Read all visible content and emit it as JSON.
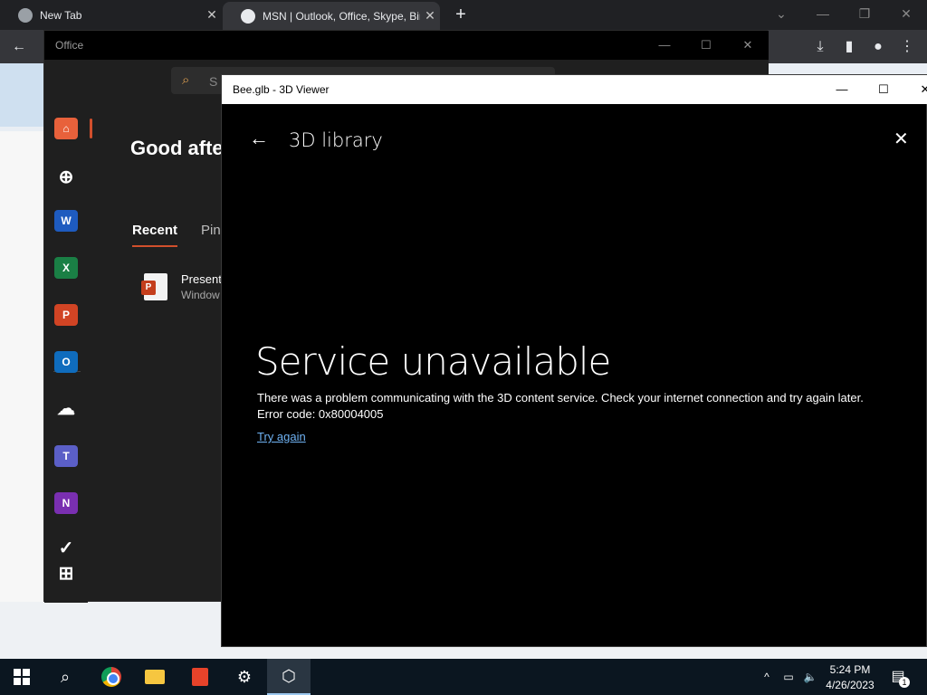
{
  "chrome": {
    "tabs": [
      {
        "title": "New Tab",
        "close": "✕"
      },
      {
        "title": "MSN | Outlook, Office, Skype, Bir",
        "close": "✕"
      }
    ],
    "new_tab": "+",
    "window_controls": {
      "dropdown": "⌄",
      "minimize": "—",
      "restore": "❐",
      "close": "✕"
    },
    "toolbar": {
      "back": "←",
      "download": "⤓",
      "sidebar": "▮",
      "profile": "●",
      "menu": "⋮"
    }
  },
  "office": {
    "title": "Office",
    "window_controls": {
      "minimize": "—",
      "maximize": "☐",
      "close": "✕"
    },
    "search_icon": "⌕",
    "search_text": "S",
    "greeting": "Good afte",
    "tabs": {
      "recent": "Recent",
      "pinned": "Pin"
    },
    "file": {
      "name": "Present",
      "location": "Window",
      "badge": "P"
    },
    "rail": [
      {
        "name": "home-icon",
        "glyph": "⌂",
        "color": "#e8613b"
      },
      {
        "name": "create-icon",
        "glyph": "⊕",
        "color": "transparent"
      },
      {
        "name": "word-icon",
        "glyph": "W",
        "color": "#1e5bbf"
      },
      {
        "name": "excel-icon",
        "glyph": "X",
        "color": "#1a7f45"
      },
      {
        "name": "powerpoint-icon",
        "glyph": "P",
        "color": "#d14424"
      },
      {
        "name": "outlook-icon",
        "glyph": "O",
        "color": "#0f6cbd"
      },
      {
        "name": "onedrive-icon",
        "glyph": "☁",
        "color": "transparent"
      },
      {
        "name": "teams-icon",
        "glyph": "T",
        "color": "#5b5fc7"
      },
      {
        "name": "onenote-icon",
        "glyph": "N",
        "color": "#7a2fb1"
      },
      {
        "name": "todo-icon",
        "glyph": "✓",
        "color": "transparent"
      },
      {
        "name": "apps-icon",
        "glyph": "⊞",
        "color": "transparent"
      }
    ]
  },
  "viewer": {
    "title": "Bee.glb - 3D Viewer",
    "window_controls": {
      "minimize": "—",
      "maximize": "☐",
      "close": "✕"
    },
    "back": "←",
    "heading": "3D library",
    "close": "✕",
    "error": {
      "title": "Service unavailable",
      "message": "There was a problem communicating with the 3D content service. Check your internet connection and try again later.",
      "code": "Error code: 0x80004005",
      "retry": "Try again"
    }
  },
  "taskbar": {
    "search_icon": "⌕",
    "settings_icon": "⚙",
    "viewer_icon": "⬡",
    "tray": {
      "chevron": "^",
      "network": "▭",
      "volume": "🔈"
    },
    "time": "5:24 PM",
    "date": "4/26/2023",
    "notification_count": "1",
    "notification_icon": "▤"
  }
}
